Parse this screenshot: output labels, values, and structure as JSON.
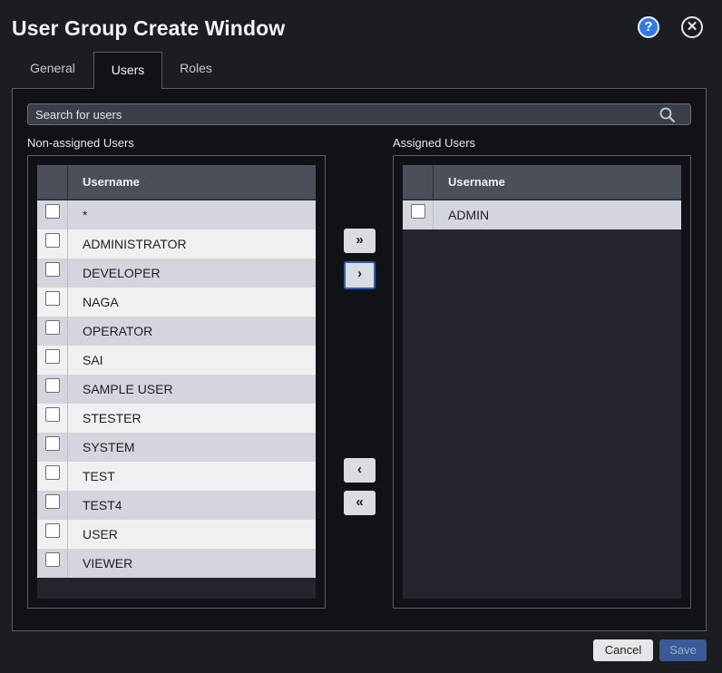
{
  "window": {
    "title": "User Group Create Window",
    "help_glyph": "?",
    "close_glyph": "✕"
  },
  "tabs": [
    {
      "label": "General",
      "active": false
    },
    {
      "label": "Users",
      "active": true
    },
    {
      "label": "Roles",
      "active": false
    }
  ],
  "search": {
    "placeholder": "Search for users",
    "icon": "search-icon"
  },
  "non_assigned": {
    "label": "Non-assigned Users",
    "column_header": "Username",
    "rows": [
      "*",
      "ADMINISTRATOR",
      "DEVELOPER",
      "NAGA",
      "OPERATOR",
      "SAI",
      "SAMPLE USER",
      "STESTER",
      "SYSTEM",
      "TEST",
      "TEST4",
      "USER",
      "VIEWER"
    ]
  },
  "assigned": {
    "label": "Assigned Users",
    "column_header": "Username",
    "rows": [
      "ADMIN"
    ]
  },
  "move_buttons": {
    "all_right": "»",
    "right": "›",
    "left": "‹",
    "all_left": "«"
  },
  "footer": {
    "cancel_label": "Cancel",
    "save_label": "Save"
  },
  "colors": {
    "background": "#1b1d23",
    "panel": "#101217",
    "accent": "#2f7ae5",
    "save_disabled": "#3a5a96"
  }
}
